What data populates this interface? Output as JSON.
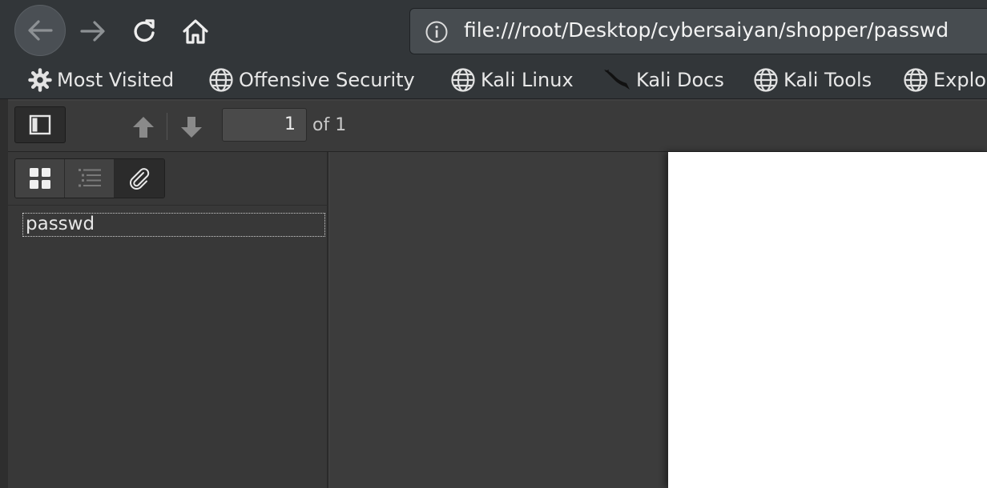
{
  "browser": {
    "url": "file:///root/Desktop/cybersaiyan/shopper/passwd",
    "icons": {
      "back": "back-arrow-icon",
      "forward": "forward-arrow-icon",
      "reload": "reload-icon",
      "home": "home-icon",
      "site_info": "info-icon"
    }
  },
  "bookmarks": [
    {
      "label": "Most Visited",
      "icon": "gear-icon"
    },
    {
      "label": "Offensive Security",
      "icon": "globe-icon"
    },
    {
      "label": "Kali Linux",
      "icon": "globe-icon"
    },
    {
      "label": "Kali Docs",
      "icon": "kali-dragon-icon"
    },
    {
      "label": "Kali Tools",
      "icon": "globe-icon"
    },
    {
      "label": "Explo",
      "icon": "globe-icon"
    }
  ],
  "pdf_toolbar": {
    "page_number": "1",
    "page_count_label": "of 1"
  },
  "sidebar": {
    "tabs": [
      "thumbnails",
      "outline",
      "attachments"
    ],
    "active_tab": "attachments",
    "attachments": [
      {
        "name": "passwd"
      }
    ]
  },
  "colors": {
    "chrome_bg": "#323639",
    "toolbar_bg": "#3a3a3a",
    "sidebar_bg": "#383838",
    "viewer_bg": "#3c3c3c",
    "page_bg": "#ffffff"
  }
}
